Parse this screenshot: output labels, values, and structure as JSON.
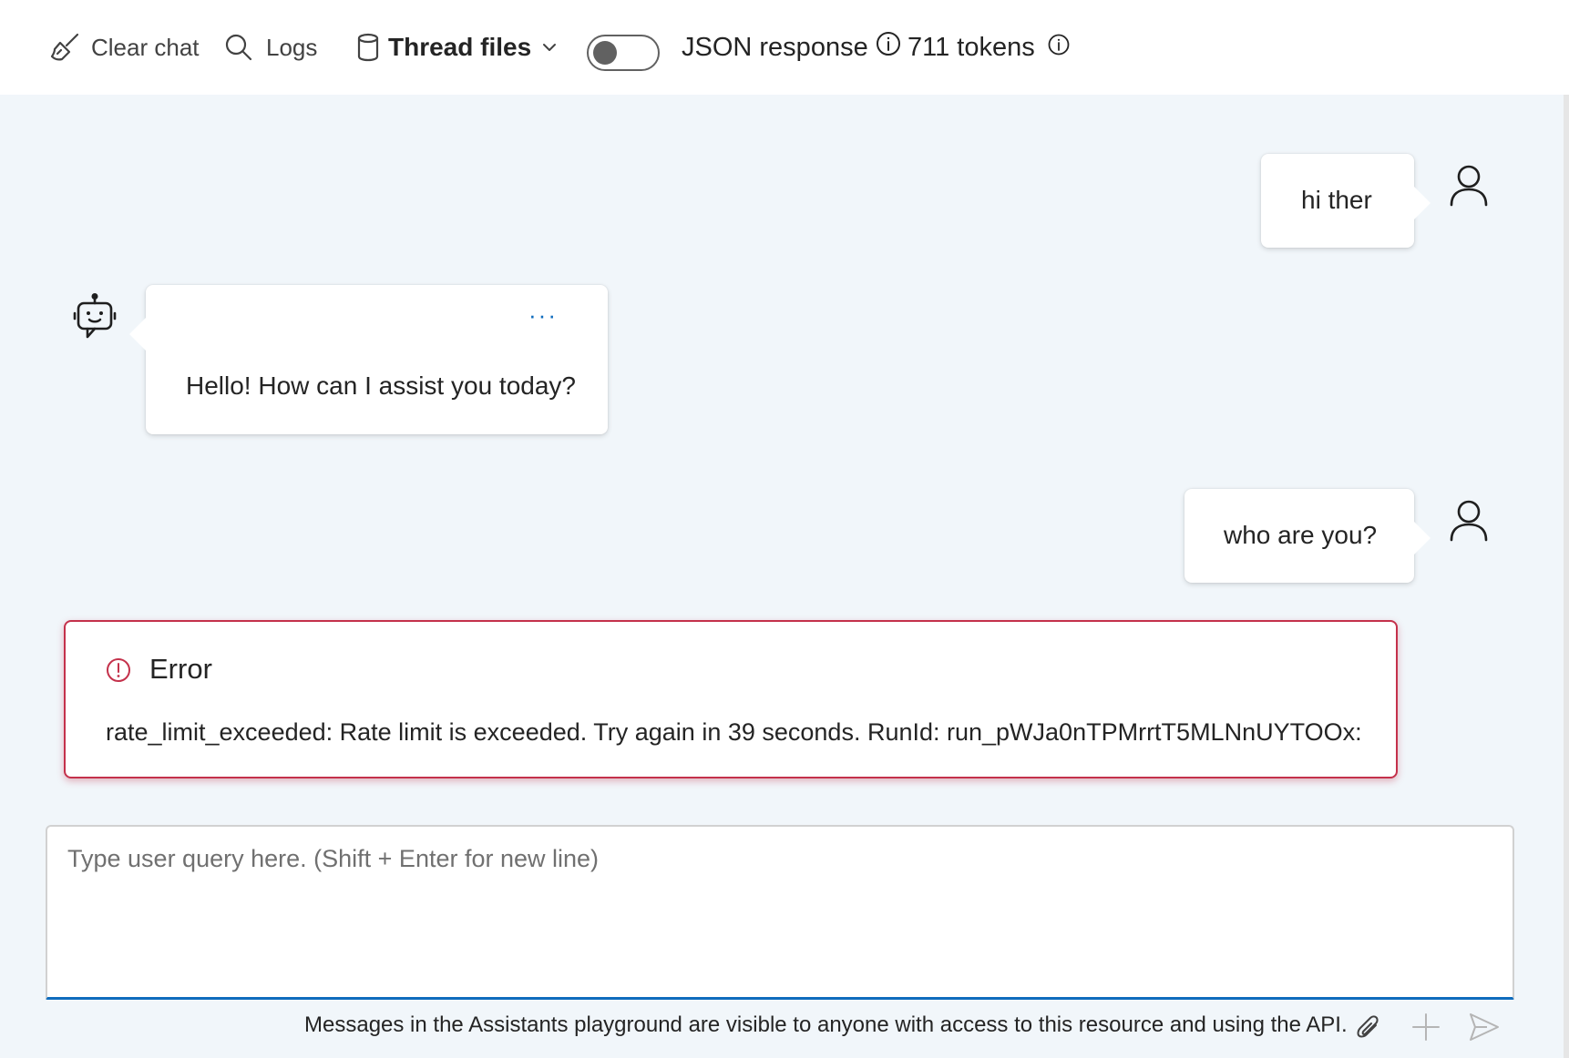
{
  "toolbar": {
    "clear_chat_label": "Clear chat",
    "logs_label": "Logs",
    "thread_files_label": "Thread files",
    "json_response_label": "JSON response",
    "json_response_enabled": false,
    "tokens_label": "711 tokens"
  },
  "messages": [
    {
      "role": "user",
      "text": "hi ther"
    },
    {
      "role": "assistant",
      "text": "Hello! How can I assist you today?",
      "more_label": "···"
    },
    {
      "role": "user",
      "text": "who are you?"
    }
  ],
  "error": {
    "title": "Error",
    "message": "rate_limit_exceeded: Rate limit is exceeded. Try again in 39 seconds. RunId: run_pWJa0nTPMrrtT5MLNnUYTOOx:"
  },
  "input": {
    "placeholder": "Type user query here. (Shift + Enter for new line)",
    "value": ""
  },
  "footer": {
    "note": "Messages in the Assistants playground are visible to anyone with access to this resource and using the API."
  },
  "icons": [
    "broom-icon",
    "search-icon",
    "database-icon",
    "chevron-down-icon",
    "info-icon",
    "person-icon",
    "bot-icon",
    "error-icon",
    "paperclip-icon",
    "plus-icon",
    "send-icon"
  ],
  "colors": {
    "accent": "#0f6cbd",
    "error": "#c4314b",
    "chat_background": "#f1f6fa"
  }
}
